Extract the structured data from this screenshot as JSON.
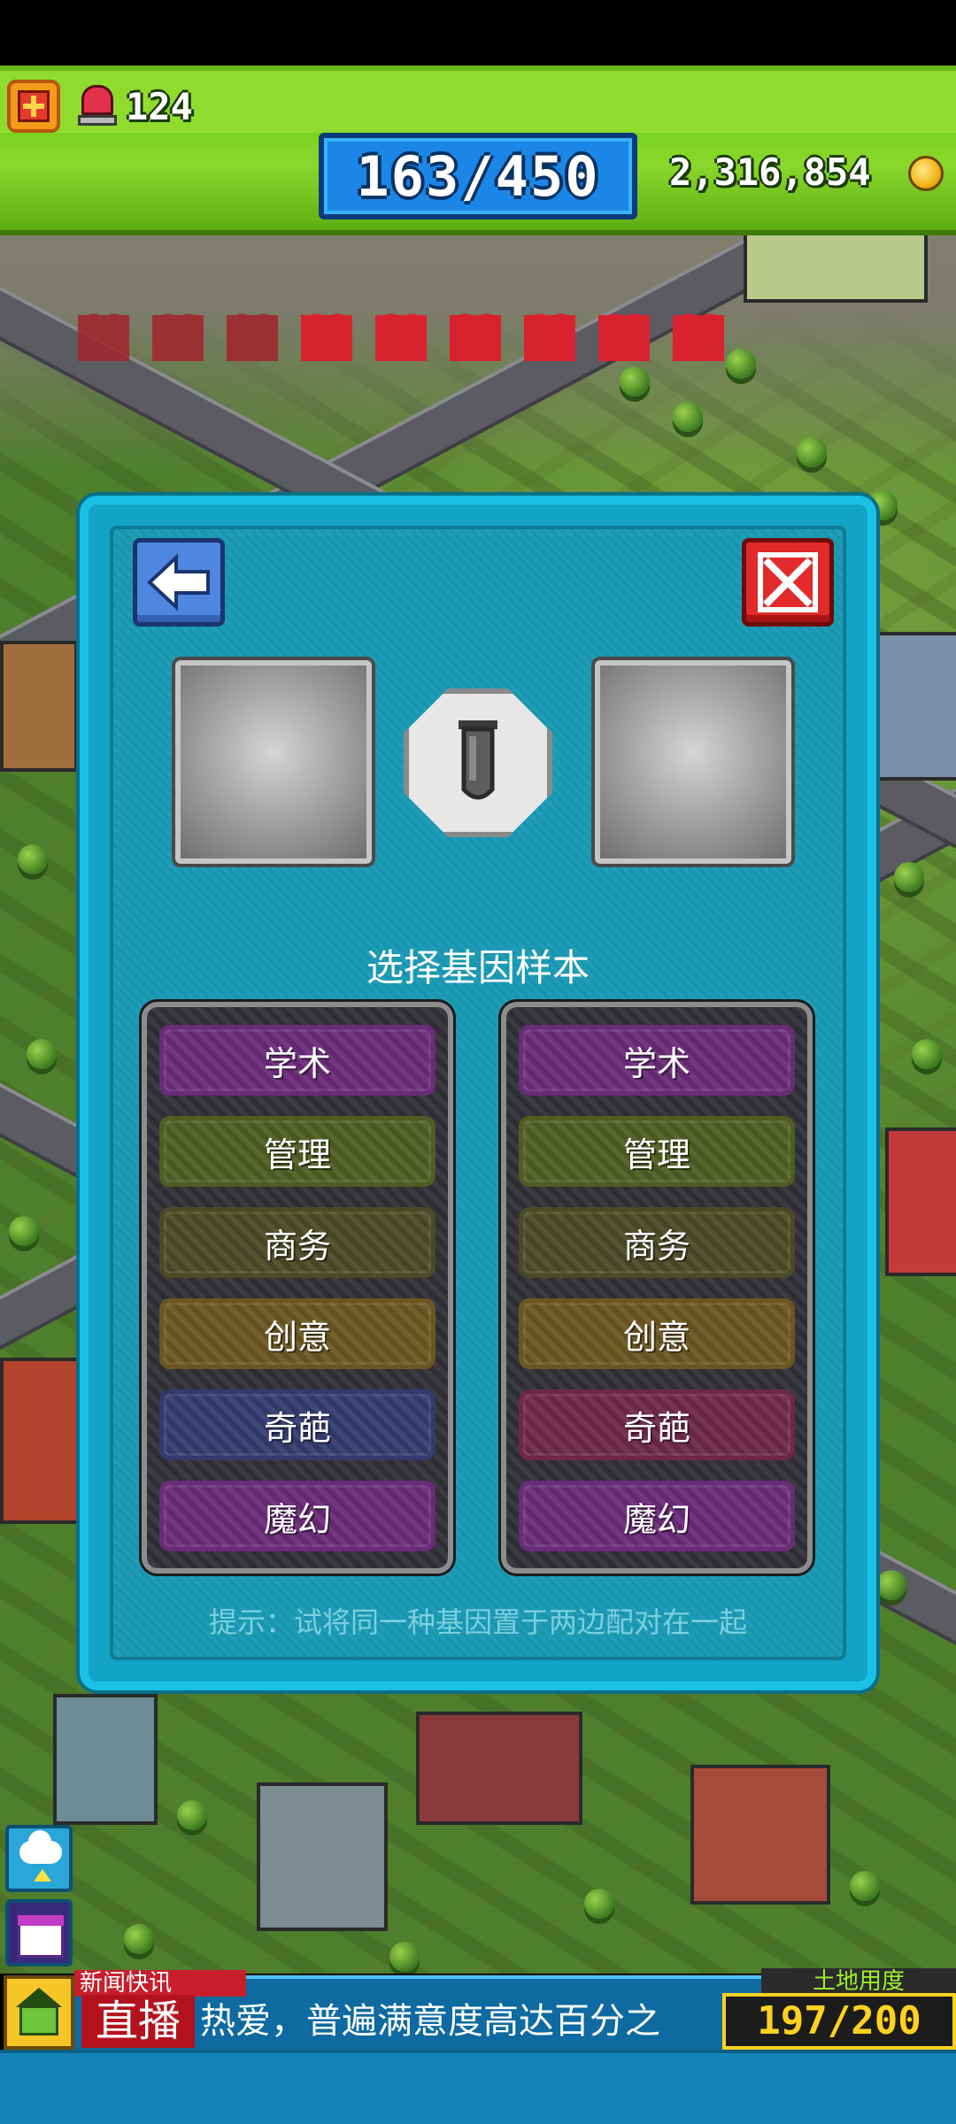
{
  "hud": {
    "alarm_count": "124",
    "population": "163/450",
    "gold": "2,316,854"
  },
  "happiness": {
    "hearts_total": 9,
    "hearts_dim": 3
  },
  "dialog": {
    "heading": "选择基因样本",
    "hint": "提示：试将同一种基因置于两边配对在一起",
    "left_genes": [
      {
        "label": "学术",
        "color": "#6a2b78"
      },
      {
        "label": "管理",
        "color": "#4f5c22"
      },
      {
        "label": "商务",
        "color": "#4a4a26"
      },
      {
        "label": "创意",
        "color": "#6b5622"
      },
      {
        "label": "奇葩",
        "color": "#343a6e"
      },
      {
        "label": "魔幻",
        "color": "#6a2b78"
      }
    ],
    "right_genes": [
      {
        "label": "学术",
        "color": "#6a2b78"
      },
      {
        "label": "管理",
        "color": "#4f5c22"
      },
      {
        "label": "商务",
        "color": "#4a4a26"
      },
      {
        "label": "创意",
        "color": "#6b5622"
      },
      {
        "label": "奇葩",
        "color": "#6e2846"
      },
      {
        "label": "魔幻",
        "color": "#6a2b78"
      }
    ],
    "icons": {
      "back": "back-arrow-icon",
      "close": "close-x-icon",
      "center": "test-tube-icon"
    }
  },
  "news": {
    "tag": "新闻快讯",
    "live": "直播",
    "ticker": "热爱，普遍满意度高达百分之"
  },
  "land": {
    "label": "土地用度",
    "value": "197/200"
  }
}
